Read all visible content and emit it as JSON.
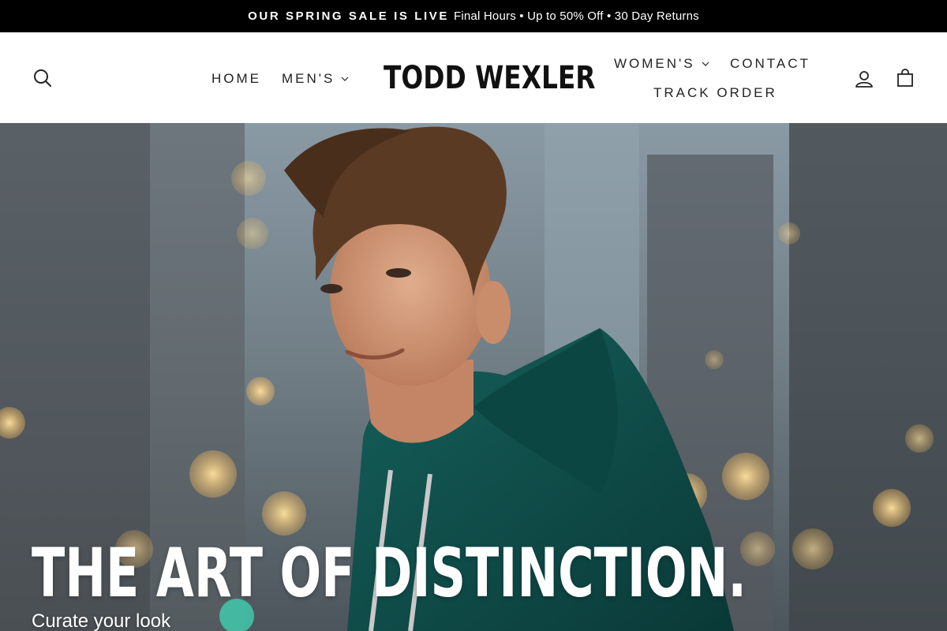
{
  "announcement": {
    "bold_text": "OUR SPRING SALE IS LIVE",
    "text": "Final Hours • Up to 50% Off • 30 Day Returns"
  },
  "header": {
    "logo": "TODD WEXLER",
    "nav": {
      "home": "HOME",
      "mens": "MEN'S",
      "womens": "WOMEN'S",
      "contact": "CONTACT",
      "track_order": "TRACK ORDER"
    },
    "icons": [
      "search-icon",
      "account-icon",
      "cart-icon",
      "chevron-down-icon"
    ]
  },
  "hero": {
    "title": "THE ART OF DISTINCTION.",
    "subtitle": "Curate your look",
    "colors": {
      "hoodie": "#0f4a47",
      "background": "#5d6a76"
    }
  },
  "colors": {
    "announcement_bg": "#000000",
    "header_bg": "#ffffff",
    "text": "#222222"
  }
}
